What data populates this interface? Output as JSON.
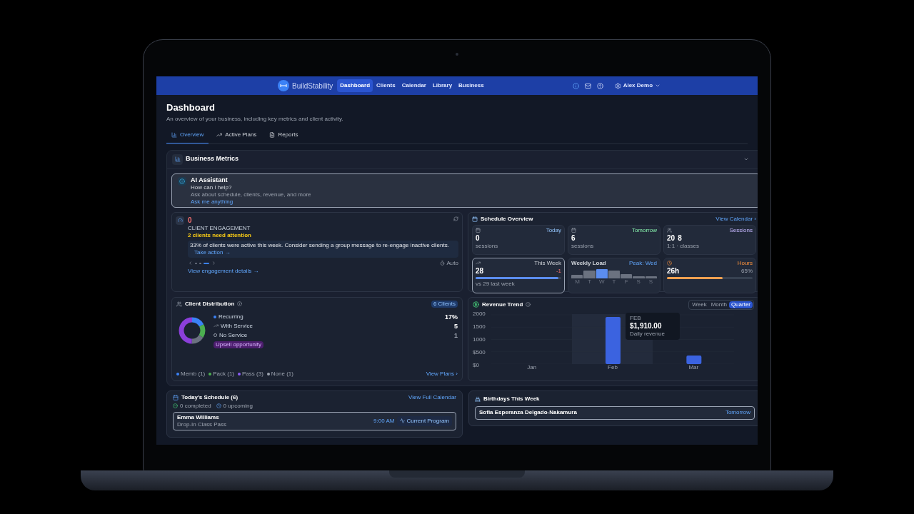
{
  "nav": {
    "brand": "BuildStability",
    "items": [
      {
        "label": "Dashboard",
        "selected": true
      },
      {
        "label": "Clients",
        "selected": false
      },
      {
        "label": "Calendar",
        "selected": false
      },
      {
        "label": "Library",
        "selected": false
      },
      {
        "label": "Business",
        "selected": false
      }
    ],
    "user": "Alex Demo"
  },
  "page": {
    "title": "Dashboard",
    "subtitle": "An overview of your business, including key metrics and client activity.",
    "tabs": [
      {
        "label": "Overview",
        "selected": true
      },
      {
        "label": "Active Plans",
        "selected": false
      },
      {
        "label": "Reports",
        "selected": false
      }
    ]
  },
  "metrics": {
    "title": "Business Metrics",
    "assistant": {
      "title": "AI Assistant",
      "prompt": "How can I help?",
      "hint": "Ask about schedule, clients, revenue, and more",
      "link": "Ask me anything"
    },
    "engagement": {
      "value": "0",
      "label": "CLIENT ENGAGEMENT",
      "warning": "2 clients need attention",
      "message": "33% of clients were active this week. Consider sending a group message to re-engage inactive clients.",
      "action": "Take action →",
      "slides": [
        {
          "selected": false
        },
        {
          "selected": false
        },
        {
          "selected": true
        }
      ],
      "auto": "Auto",
      "details": "View engagement details →"
    },
    "schedule": {
      "title": "Schedule Overview",
      "link": "View Calendar ›",
      "today": {
        "label": "Today",
        "value": "0",
        "note": "sessions"
      },
      "tomorrow": {
        "label": "Tomorrow",
        "value": "6",
        "note": "sessions"
      },
      "sessions": {
        "label": "Sessions",
        "one": "20",
        "classes": "8",
        "note": "1:1 · classes"
      },
      "week": {
        "label": "This Week",
        "value": "28",
        "delta": "-1",
        "level": 0.97,
        "note": "vs 29 last week"
      },
      "load": {
        "title": "Weekly Load",
        "peak": "Peak: Wed",
        "days": [
          {
            "label": "M",
            "highlighted": false
          },
          {
            "label": "T",
            "highlighted": false
          },
          {
            "label": "W",
            "highlighted": true
          },
          {
            "label": "T",
            "highlighted": false
          },
          {
            "label": "F",
            "highlighted": false
          },
          {
            "label": "S",
            "highlighted": false
          },
          {
            "label": "S",
            "highlighted": false
          }
        ]
      },
      "hours": {
        "label": "Hours",
        "value": "26h",
        "percent": "65%",
        "level": 0.65
      }
    },
    "distribution": {
      "title": "Client Distribution",
      "badge": "6 Clients",
      "segments": [
        {
          "color": "#3b82f6"
        },
        {
          "color": "#4caf50"
        },
        {
          "color": "#6b7280"
        },
        {
          "color": "#8b3fd9"
        }
      ],
      "legend": [
        {
          "kind": "dot",
          "label": "Recurring",
          "value": "17%"
        },
        {
          "kind": "trend",
          "label": "With Service",
          "value": "5"
        },
        {
          "kind": "ring",
          "label": "No Service",
          "value": "1"
        }
      ],
      "upsell": "Upsell opportunity",
      "plans": [
        {
          "label": "Memb (1)",
          "color": "#3b82f6"
        },
        {
          "label": "Pack (1)",
          "color": "#4caf50"
        },
        {
          "label": "Pass (3)",
          "color": "#8b5cf6"
        },
        {
          "label": "None (1)",
          "color": "#9ca3af"
        }
      ],
      "link": "View Plans ›"
    },
    "revenue": {
      "title": "Revenue Trend",
      "ranges": [
        {
          "label": "Week",
          "selected": false
        },
        {
          "label": "Month",
          "selected": false
        },
        {
          "label": "Quarter",
          "selected": true
        }
      ],
      "tooltip": {
        "month": "FEB",
        "amount": "$1,910.00",
        "note": "Daily revenue"
      },
      "chart_data": {
        "type": "bar",
        "categories": [
          "Jan",
          "Feb",
          "Mar"
        ],
        "values": [
          0,
          1910,
          350
        ],
        "ylim": [
          0,
          2000
        ],
        "yticks": [
          {
            "value": 2000,
            "label": "2000"
          },
          {
            "value": 1500,
            "label": "1500"
          },
          {
            "value": 1000,
            "label": "1000"
          },
          {
            "value": 500,
            "label": "$500"
          },
          {
            "value": 0,
            "label": "$0"
          }
        ]
      }
    }
  },
  "today": {
    "title": "Today's Schedule (6)",
    "link": "View Full Calendar",
    "completed": "0 completed",
    "upcoming": "0 upcoming",
    "entry": {
      "name": "Emma Williams",
      "plan": "Drop-In Class Pass",
      "time": "9:00 AM",
      "program": "Current Program"
    }
  },
  "birthdays": {
    "title": "Birthdays This Week",
    "name": "Sofia Esperanza Delgado-Nakamura",
    "when": "Tomorrow"
  }
}
